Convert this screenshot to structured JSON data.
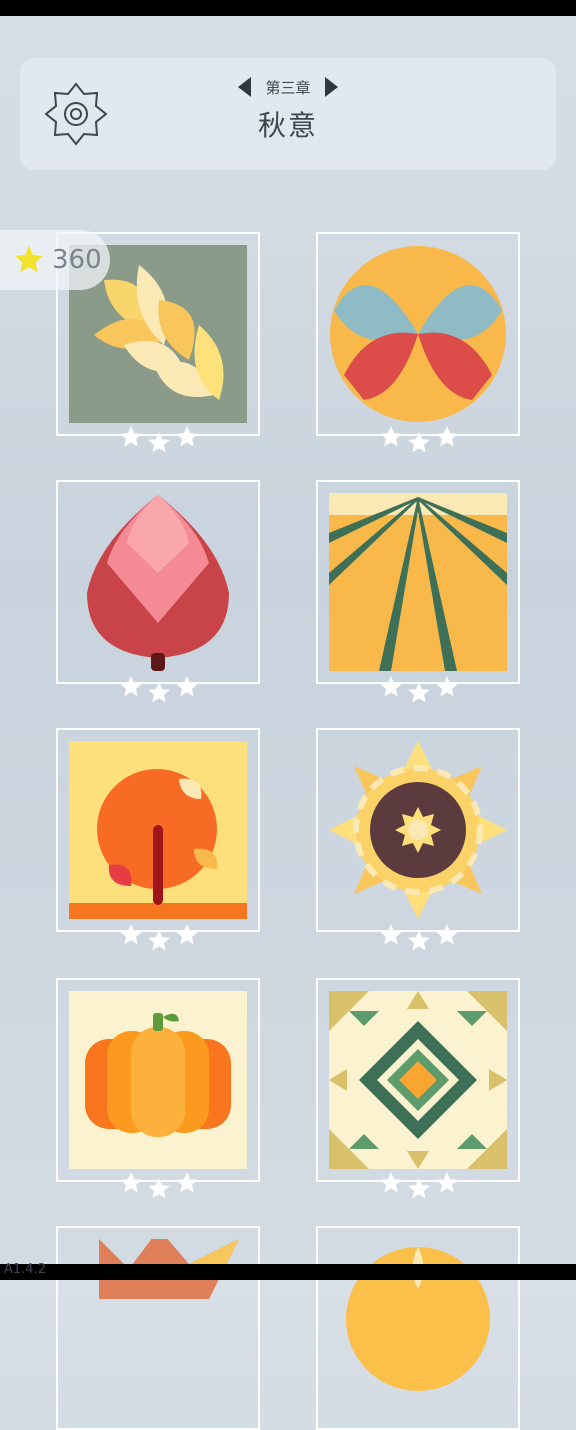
{
  "header": {
    "chapter_label": "第三章",
    "chapter_title": "秋意"
  },
  "stars_total": "360",
  "levels": [
    {
      "name": "leaves",
      "stars": 0
    },
    {
      "name": "circle-petals",
      "stars": 0
    },
    {
      "name": "red-leaf",
      "stars": 0
    },
    {
      "name": "field-rows",
      "stars": 0
    },
    {
      "name": "orange-tree",
      "stars": 0
    },
    {
      "name": "sunflower",
      "stars": 0
    },
    {
      "name": "pumpkin",
      "stars": 0
    },
    {
      "name": "quilt-pattern",
      "stars": 0
    },
    {
      "name": "maple-leaf",
      "stars": 0
    },
    {
      "name": "round-fruit",
      "stars": 0
    }
  ],
  "version": "A1.4.2",
  "colors": {
    "star_gold": "#f3e22c",
    "tile_border": "#ffffff",
    "text_dark": "#3e4650"
  }
}
